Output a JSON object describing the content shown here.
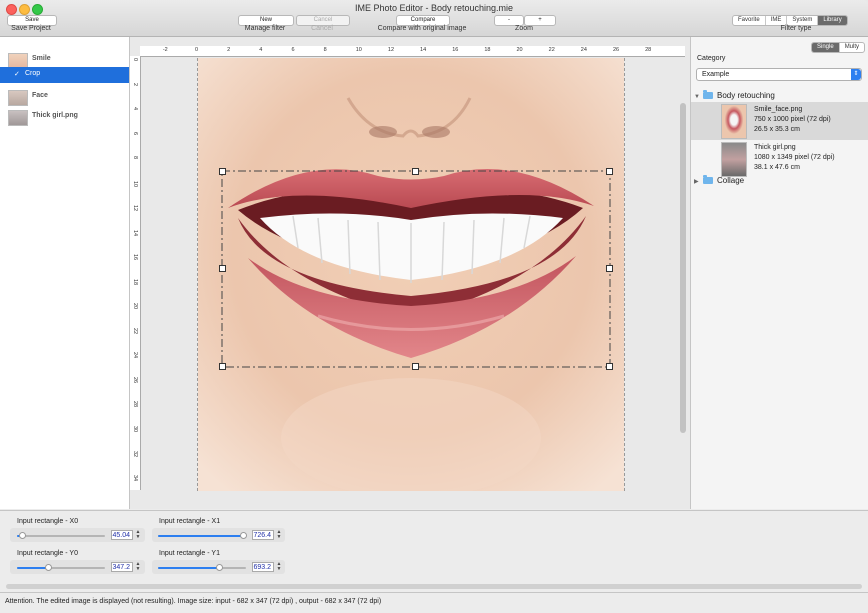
{
  "window": {
    "title": "IME Photo Editor - Body retouching.mie"
  },
  "toolbar": {
    "save": {
      "button": "Save",
      "caption": "Save Project"
    },
    "filter": {
      "new": "New",
      "cancel": "Cancel",
      "caption": "Manage filter",
      "cancel_caption": "Cancel"
    },
    "compare": {
      "button": "Compare",
      "caption": "Compare with original image"
    },
    "zoom": {
      "minus": "-",
      "plus": "+",
      "caption": "Zoom"
    },
    "filter_type": {
      "tabs": [
        "Favorite",
        "IME",
        "System",
        "Library"
      ],
      "active": "Library",
      "caption": "Filter type"
    }
  },
  "filters": [
    {
      "label": "Smile",
      "selected": false
    },
    {
      "label": "Crop",
      "selected": true
    },
    {
      "label": "Face",
      "selected": false
    },
    {
      "label": "Thick girl.png",
      "selected": false
    }
  ],
  "ruler": {
    "h_ticks": [
      "-2",
      "0",
      "2",
      "4",
      "6",
      "8",
      "10",
      "12",
      "14",
      "16",
      "18",
      "20",
      "22",
      "24",
      "26",
      "28"
    ],
    "v_ticks": [
      "0",
      "2",
      "4",
      "6",
      "8",
      "10",
      "12",
      "14",
      "16",
      "18",
      "20",
      "22",
      "24",
      "26",
      "28",
      "30",
      "32",
      "34"
    ]
  },
  "library": {
    "mode_tabs": [
      "Single",
      "Multy"
    ],
    "active_mode": "Single",
    "category_label": "Category",
    "category_value": "Example",
    "folders": [
      {
        "name": "Body retouching",
        "expanded": true
      },
      {
        "name": "Collage",
        "expanded": false
      }
    ],
    "items": [
      {
        "name": "Smile_face.png",
        "pixels": "750 x 1000 pixel (72 dpi)",
        "size": "26.5 x 35.3 cm",
        "selected": true
      },
      {
        "name": "Thick girl.png",
        "pixels": "1080 x 1349 pixel (72 dpi)",
        "size": "38.1 x 47.6 cm",
        "selected": false
      }
    ]
  },
  "params": {
    "x0": {
      "label": "Input rectangle - X0",
      "value": "45.04",
      "fraction": 0.06
    },
    "x1": {
      "label": "Input rectangle - X1",
      "value": "726.4",
      "fraction": 0.97
    },
    "y0": {
      "label": "Input rectangle - Y0",
      "value": "347.2",
      "fraction": 0.35
    },
    "y1": {
      "label": "Input rectangle - Y1",
      "value": "693.2",
      "fraction": 0.69
    }
  },
  "status": "Attention. The edited image is displayed (not resulting).  Image size: input - 682 x 347 (72 dpi) , output - 682 x 347 (72 dpi)",
  "colors": {
    "accent": "#1f6fdc",
    "slider": "#2d7ff0",
    "lips": "#c2545d",
    "skin": "#e8c3a6"
  }
}
